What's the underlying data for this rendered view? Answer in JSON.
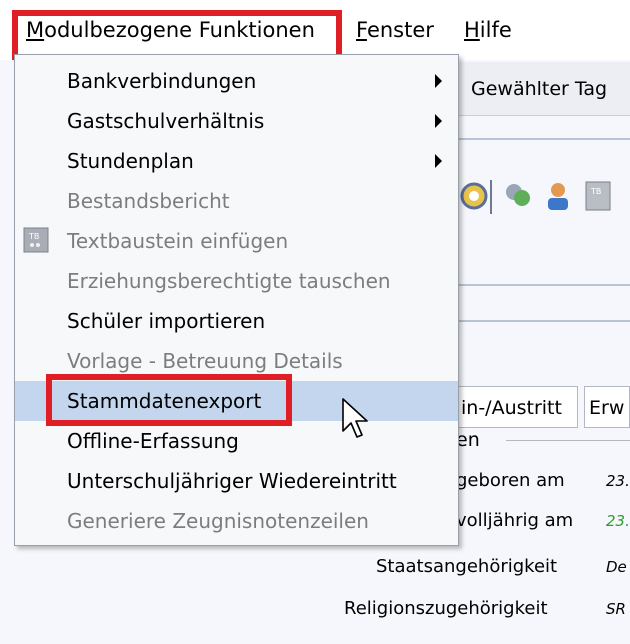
{
  "menubar": {
    "items": [
      {
        "label": "Modulbezogene Funktionen",
        "mnemonic": "M"
      },
      {
        "label": "Fenster",
        "mnemonic": "F"
      },
      {
        "label": "Hilfe",
        "mnemonic": "H"
      }
    ]
  },
  "background": {
    "selected_day_label": "Gewählter Tag",
    "tabs": [
      "in-/Austritt",
      "Erw"
    ],
    "group_label": "en",
    "rows": [
      {
        "label": "geboren am",
        "value": "23."
      },
      {
        "label": "volljährig am",
        "value": "23."
      },
      {
        "label": "Staatsangehörigkeit",
        "value": "De"
      },
      {
        "label": "Religionszugehörigkeit",
        "value": "SR"
      }
    ]
  },
  "menu": {
    "items": [
      {
        "label": "Bankverbindungen",
        "enabled": true,
        "submenu": true
      },
      {
        "label": "Gastschulverhältnis",
        "enabled": true,
        "submenu": true
      },
      {
        "label": "Stundenplan",
        "enabled": true,
        "submenu": true
      },
      {
        "label": "Bestandsbericht",
        "enabled": false,
        "submenu": false
      },
      {
        "label": "Textbaustein einfügen",
        "enabled": false,
        "submenu": false,
        "icon": "textbaustein-icon"
      },
      {
        "label": "Erziehungsberechtigte tauschen",
        "enabled": false,
        "submenu": false
      },
      {
        "label": "Schüler importieren",
        "enabled": true,
        "submenu": false
      },
      {
        "label": "Vorlage - Betreuung Details",
        "enabled": false,
        "submenu": false
      },
      {
        "label": "Stammdatenexport",
        "enabled": true,
        "submenu": false,
        "hovered": true
      },
      {
        "label": "Offline-Erfassung",
        "enabled": true,
        "submenu": false
      },
      {
        "label": "Unterschuljähriger Wiedereintritt",
        "enabled": true,
        "submenu": false
      },
      {
        "label": "Generiere Zeugnisnotenzeilen",
        "enabled": false,
        "submenu": false
      }
    ]
  },
  "colors": {
    "highlight_box": "#e01e25",
    "hover_background": "#c4d6ee",
    "disabled_text": "#7d7d7d"
  }
}
